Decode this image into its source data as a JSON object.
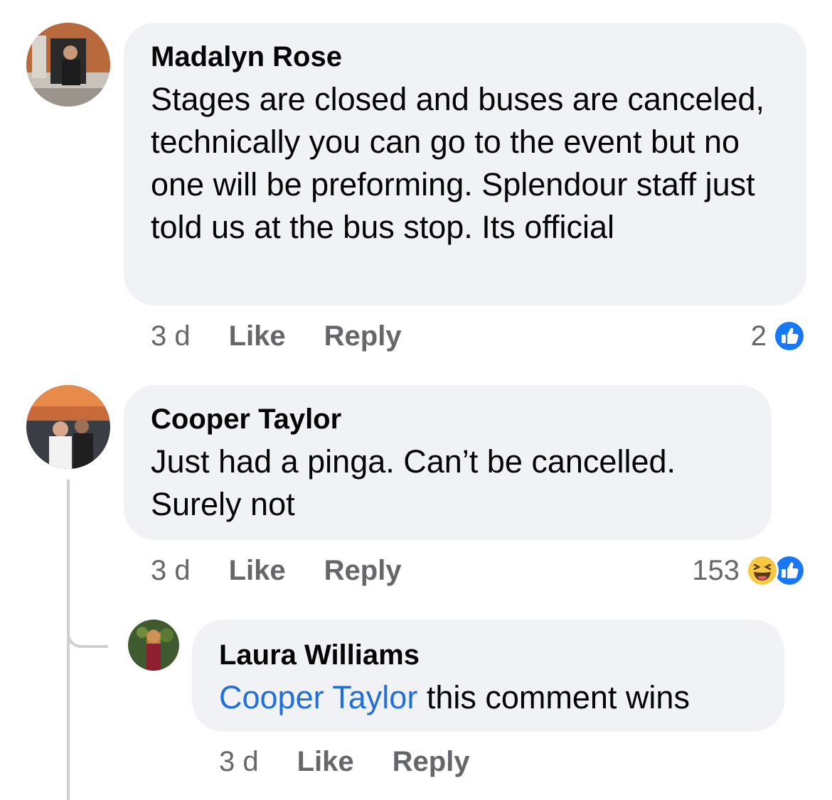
{
  "comments": [
    {
      "author": "Madalyn Rose",
      "text": "Stages are closed and buses are canceled, technically you can go to the event but no one will be preforming. Splendour staff just told us at the bus stop. Its official",
      "time": "3 d",
      "like_label": "Like",
      "reply_label": "Reply",
      "reaction_count": "2",
      "reactions": [
        "like-icon"
      ]
    },
    {
      "author": "Cooper Taylor",
      "text": "Just had a pinga. Can’t be cancelled. Surely not",
      "time": "3 d",
      "like_label": "Like",
      "reply_label": "Reply",
      "reaction_count": "153",
      "reactions": [
        "haha-icon",
        "like-icon"
      ],
      "replies": [
        {
          "author": "Laura Williams",
          "mention": "Cooper Taylor",
          "text": " this comment wins",
          "time": "3 d",
          "like_label": "Like",
          "reply_label": "Reply"
        }
      ]
    }
  ],
  "colors": {
    "bubble": "#f0f2f5",
    "meta_text": "#65676b",
    "mention": "#216fdb",
    "like_blue": "#1877f2",
    "haha_yellow": "#f7c844"
  }
}
